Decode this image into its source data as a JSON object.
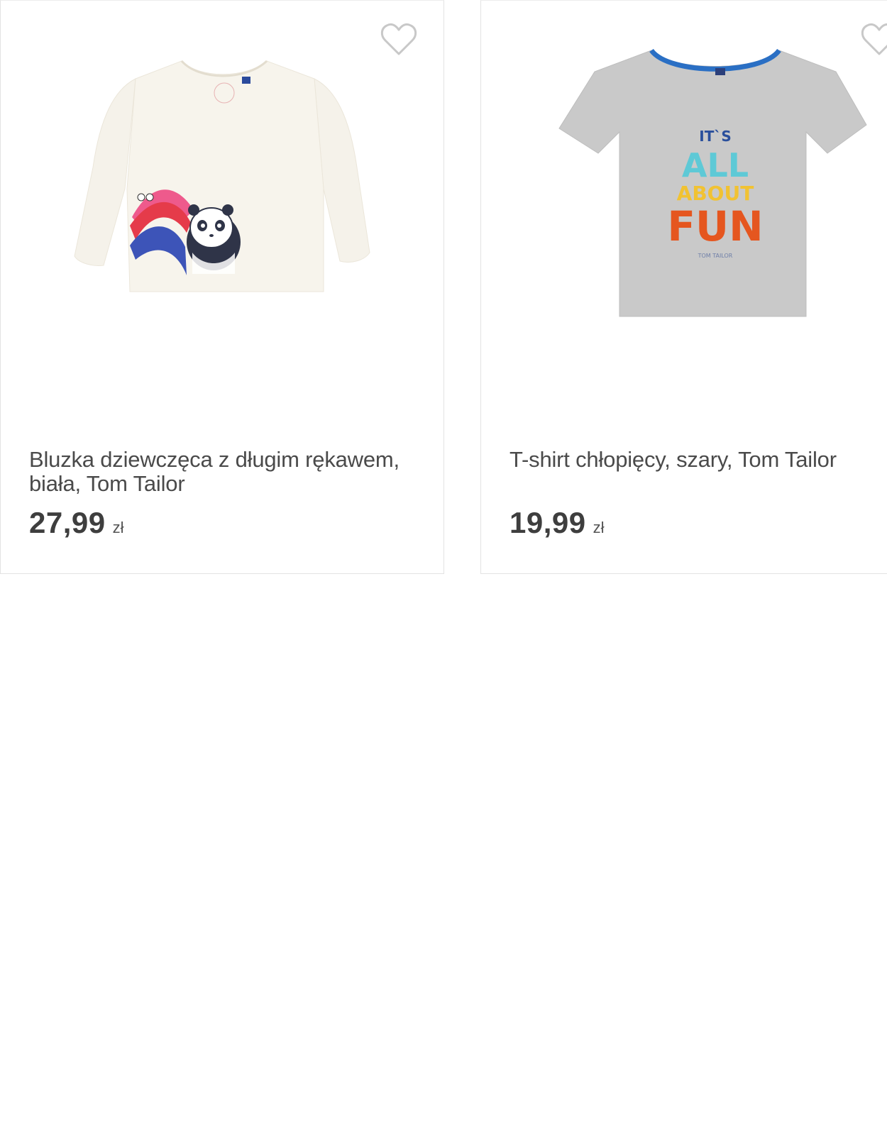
{
  "products": [
    {
      "title": "Bluzka dziewczęca z długim rękawem, biała, Tom Tailor",
      "price": "27,99",
      "currency": "zł",
      "image_icon": "white-longsleeve-panda-rainbow-shirt"
    },
    {
      "title": "T-shirt chłopięcy, szary, Tom Tailor",
      "price": "19,99",
      "currency": "zł",
      "image_icon": "grey-tshirt-its-all-about-fun",
      "print_text": [
        "IT`S",
        "ALL",
        "ABOUT",
        "FUN",
        "TOM TAILOR"
      ]
    }
  ],
  "colors": {
    "border": "#e3e3e3",
    "text": "#4a4a4a",
    "heart": "#c8c8c8"
  }
}
